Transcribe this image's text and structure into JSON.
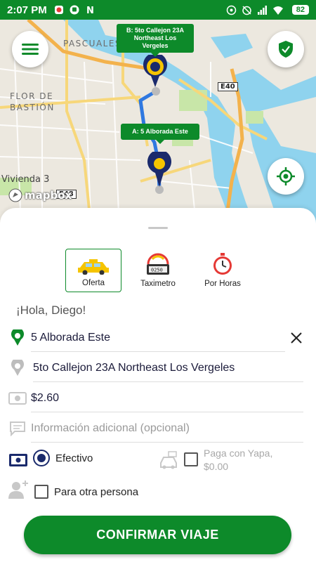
{
  "status_bar": {
    "time": "2:07 PM",
    "battery": "82"
  },
  "map": {
    "labels": {
      "pascuales": "PASCUALES",
      "flor_de": "FLOR DE",
      "bastion": "BASTIÓN",
      "vivienda": "Vivienda 3"
    },
    "road_shields": {
      "e40": "E40",
      "e48": "E48"
    },
    "mapbox_logo": "mapbox",
    "destination_tooltip": {
      "line1": "B: 5to Callejon 23A",
      "line2": "Northeast Los Vergeles"
    },
    "origin_tooltip": "A: 5 Alborada Este"
  },
  "services": [
    {
      "label": "Oferta",
      "icon": "taxi-icon",
      "active": true
    },
    {
      "label": "Taximetro",
      "icon": "taximeter-icon",
      "active": false
    },
    {
      "label": "Por Horas",
      "icon": "stopwatch-icon",
      "active": false
    }
  ],
  "greeting": "¡Hola, Diego!",
  "origin": {
    "value": "5 Alborada Este"
  },
  "destination": {
    "value": "5to Callejon 23A Northeast Los Vergeles"
  },
  "price": {
    "value": "$2.60"
  },
  "additional_info": {
    "placeholder": "Información adicional (opcional)"
  },
  "payment": {
    "cash_label": "Efectivo",
    "yapa_line1": "Paga con Yapa,",
    "yapa_line2": "$0.00"
  },
  "other_person_label": "Para otra persona",
  "confirm_button": "CONFIRMAR VIAJE",
  "colors": {
    "brand_green": "#0d8a2a",
    "pin_yellow": "#f5c400",
    "navy": "#1a2a6c"
  }
}
